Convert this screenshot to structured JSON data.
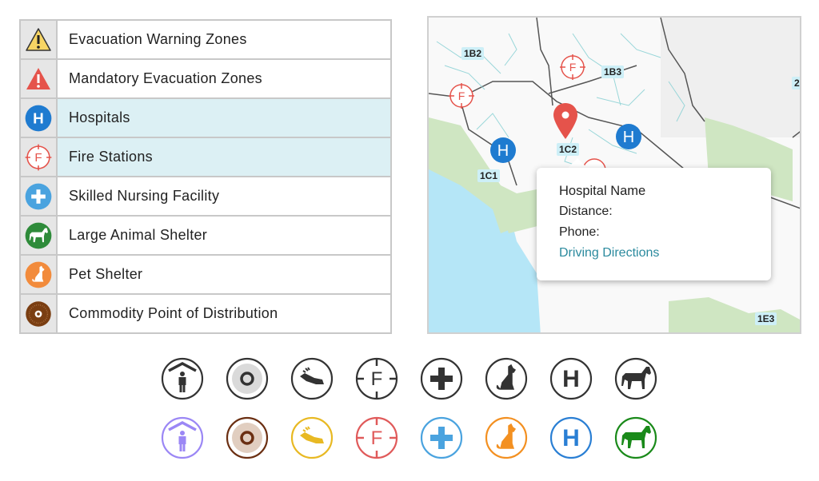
{
  "legend": {
    "items": [
      {
        "label": "Evacuation Warning Zones",
        "icon": "warning-triangle-icon",
        "color": "#f7d564",
        "highlighted": false
      },
      {
        "label": "Mandatory Evacuation Zones",
        "icon": "alert-triangle-icon",
        "color": "#e5534b",
        "highlighted": false
      },
      {
        "label": "Hospitals",
        "icon": "hospital-icon",
        "color": "#1f7bd0",
        "highlighted": true
      },
      {
        "label": "Fire Stations",
        "icon": "fire-station-icon",
        "color": "#e5534b",
        "highlighted": true
      },
      {
        "label": "Skilled Nursing Facility",
        "icon": "nursing-cross-icon",
        "color": "#4aa3df",
        "highlighted": false
      },
      {
        "label": "Large Animal Shelter",
        "icon": "horse-icon",
        "color": "#2e8b3a",
        "highlighted": false
      },
      {
        "label": "Pet Shelter",
        "icon": "dog-icon",
        "color": "#f28b3c",
        "highlighted": false
      },
      {
        "label": "Commodity Point of Distribution",
        "icon": "distribution-point-icon",
        "color": "#7a3e12",
        "highlighted": false
      }
    ]
  },
  "map": {
    "zones": [
      "1B2",
      "1B3",
      "2",
      "1C2",
      "1C1",
      "1E3"
    ],
    "popup": {
      "title": "Hospital Name",
      "distance_label": "Distance:",
      "phone_label": "Phone:",
      "link": "Driving Directions"
    }
  },
  "icon_set": {
    "mono_color": "#333333",
    "icons": [
      {
        "name": "shelter-person-icon",
        "color": "#9b87f5"
      },
      {
        "name": "distribution-point-icon",
        "color": "#6b2f12"
      },
      {
        "name": "helping-hand-icon",
        "color": "#e8b923"
      },
      {
        "name": "fire-station-icon",
        "color": "#e05a5a"
      },
      {
        "name": "nursing-cross-icon",
        "color": "#4aa3df"
      },
      {
        "name": "dog-icon",
        "color": "#f39021"
      },
      {
        "name": "hospital-icon",
        "color": "#2a7fd4"
      },
      {
        "name": "horse-icon",
        "color": "#1a8a1a"
      }
    ]
  }
}
